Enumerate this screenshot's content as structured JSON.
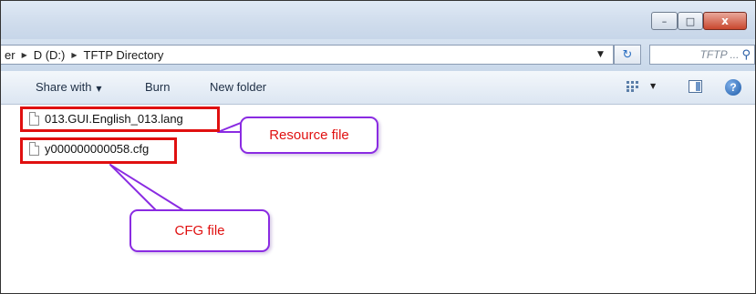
{
  "window": {
    "minimize_glyph": "–",
    "maximize_glyph": "□",
    "close_glyph": "x"
  },
  "address": {
    "crumbs": [
      "er",
      "D (D:)",
      "TFTP Directory"
    ],
    "search_placeholder": "TFTP ..."
  },
  "toolbar": {
    "share_label": "Share with",
    "burn_label": "Burn",
    "new_folder_label": "New folder"
  },
  "files": [
    {
      "name": "013.GUI.English_013.lang"
    },
    {
      "name": "y000000000058.cfg"
    }
  ],
  "annotations": {
    "resource_label": "Resource file",
    "cfg_label": "CFG file",
    "highlight_color": "#e01010",
    "callout_border_color": "#8a2be2"
  },
  "icons": [
    "file-icon",
    "search-icon",
    "refresh-icon",
    "views-icon",
    "preview-pane-icon",
    "help-icon"
  ]
}
